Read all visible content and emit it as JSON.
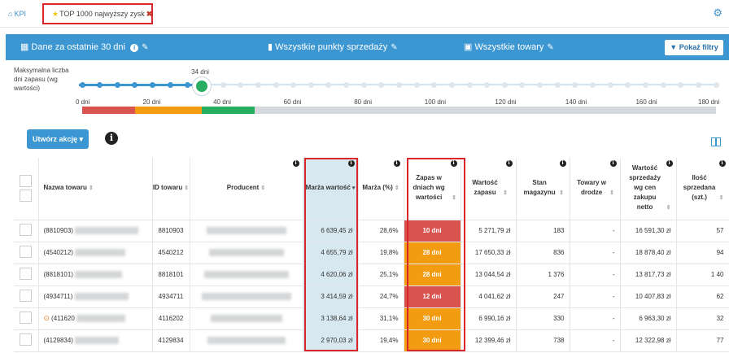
{
  "tabs": {
    "kpi_label": "KPI",
    "active_label": "TOP 1000 najwyższy zysk"
  },
  "filters": {
    "period": "Dane za ostatnie 30 dni",
    "points": "Wszystkie punkty sprzedaży",
    "products": "Wszystkie towary",
    "show_filters": "Pokaż filtry"
  },
  "slider": {
    "label": "Maksymalna liczba dni zapasu (wg wartości)",
    "value_label": "34 dni",
    "value": 34,
    "max": 180,
    "ticks": [
      "0 dni",
      "20 dni",
      "40 dni",
      "60 dni",
      "80 dni",
      "100 dni",
      "120 dni",
      "140 dni",
      "160 dni",
      "180 dni"
    ],
    "zones": [
      {
        "from": 0,
        "to": 15,
        "color": "#d9534f"
      },
      {
        "from": 15,
        "to": 34,
        "color": "#f39c12"
      },
      {
        "from": 34,
        "to": 49,
        "color": "#27ae60"
      },
      {
        "from": 49,
        "to": 180,
        "color": "#d5d9de"
      }
    ]
  },
  "actions": {
    "create_action": "Utwórz akcję"
  },
  "table": {
    "headers": {
      "name": "Nazwa towaru",
      "id": "ID towaru",
      "producer": "Producent",
      "margin_value": "Marża wartość",
      "margin_pct": "Marża (%)",
      "stock_days": "Zapas w dniach wg wartości",
      "stock_value": "Wartość zapasu",
      "stock_qty": "Stan magazynu",
      "in_transit": "Towary w drodze",
      "sales_value": "Wartość sprzedaży wg cen zakupu netto",
      "sold_qty": "Ilość sprzedana (szt.)"
    },
    "rows": [
      {
        "name": "(8810903)",
        "id": "8810903",
        "margin_value": "6 639,45 zł",
        "margin_pct": "28,6%",
        "days": "10 dni",
        "days_color": "#d9534f",
        "stock_value": "5 271,79 zł",
        "stock_qty": "183",
        "transit": "-",
        "sales": "16 591,30 zł",
        "sold": "57",
        "warn": false
      },
      {
        "name": "(4540212)",
        "id": "4540212",
        "margin_value": "4 655,79 zł",
        "margin_pct": "19,8%",
        "days": "28 dni",
        "days_color": "#f39c12",
        "stock_value": "17 650,33 zł",
        "stock_qty": "836",
        "transit": "-",
        "sales": "18 878,40 zł",
        "sold": "94",
        "warn": false
      },
      {
        "name": "(8818101)",
        "id": "8818101",
        "margin_value": "4 620,06 zł",
        "margin_pct": "25,1%",
        "days": "28 dni",
        "days_color": "#f39c12",
        "stock_value": "13 044,54 zł",
        "stock_qty": "1 376",
        "transit": "-",
        "sales": "13 817,73 zł",
        "sold": "1 40",
        "warn": false
      },
      {
        "name": "(4934711)",
        "id": "4934711",
        "margin_value": "3 414,59 zł",
        "margin_pct": "24,7%",
        "days": "12 dni",
        "days_color": "#d9534f",
        "stock_value": "4 041,62 zł",
        "stock_qty": "247",
        "transit": "-",
        "sales": "10 407,83 zł",
        "sold": "62",
        "warn": false
      },
      {
        "name": "(411620",
        "id": "4116202",
        "margin_value": "3 138,64 zł",
        "margin_pct": "31,1%",
        "days": "30 dni",
        "days_color": "#f39c12",
        "stock_value": "6 990,16 zł",
        "stock_qty": "330",
        "transit": "-",
        "sales": "6 963,30 zł",
        "sold": "32",
        "warn": true
      },
      {
        "name": "(4129834)",
        "id": "4129834",
        "margin_value": "2 970,03 zł",
        "margin_pct": "19,4%",
        "days": "30 dni",
        "days_color": "#f39c12",
        "stock_value": "12 399,46 zł",
        "stock_qty": "738",
        "transit": "-",
        "sales": "12 322,98 zł",
        "sold": "77",
        "warn": false
      }
    ]
  }
}
